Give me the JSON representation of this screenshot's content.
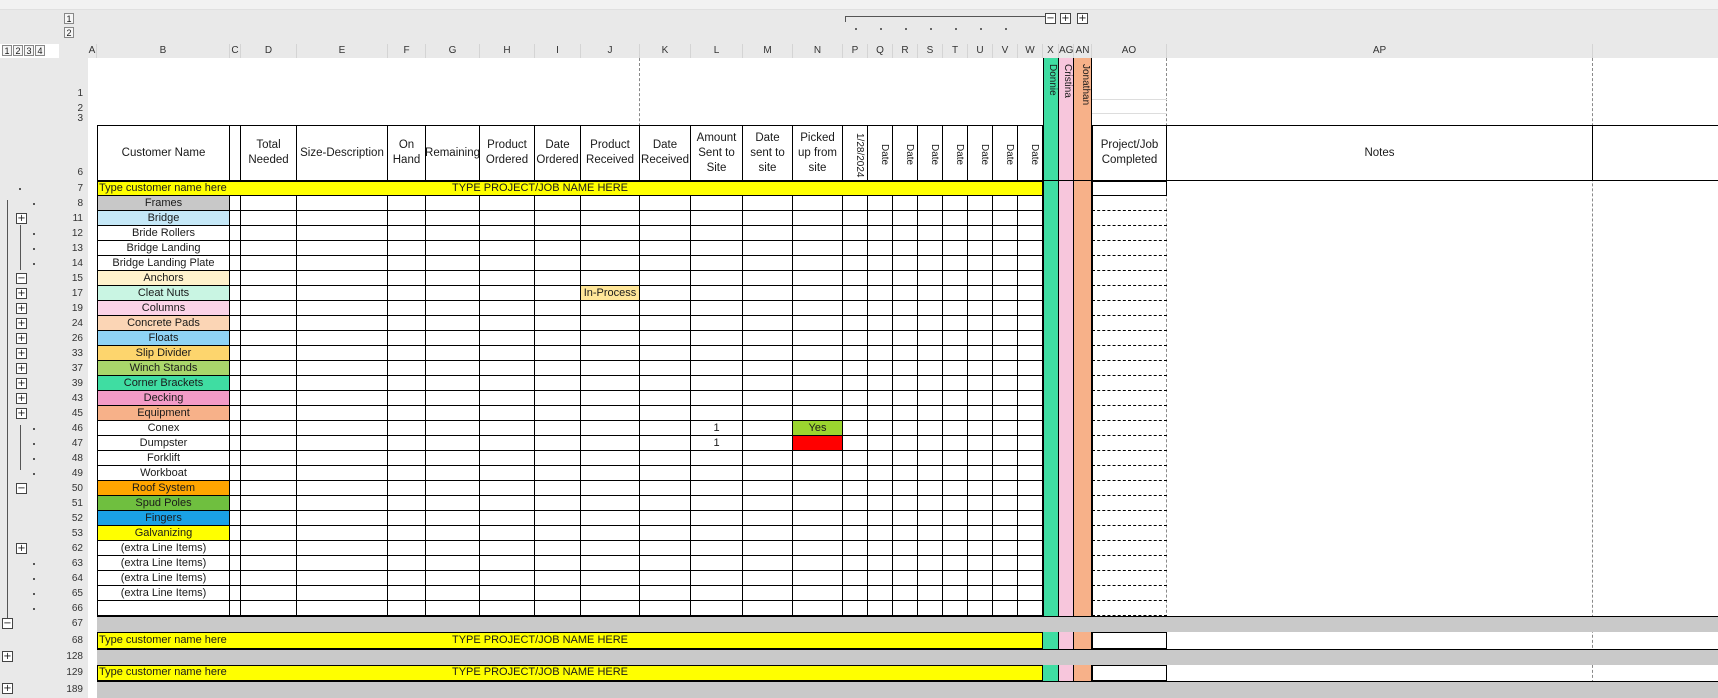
{
  "outline": {
    "row_levels": [
      "1",
      "2",
      "3",
      "4"
    ],
    "col_levels": [
      "1",
      "2"
    ]
  },
  "columns": [
    {
      "letter": "A"
    },
    {
      "letter": "B"
    },
    {
      "letter": "C"
    },
    {
      "letter": "D"
    },
    {
      "letter": "E"
    },
    {
      "letter": "F"
    },
    {
      "letter": "G"
    },
    {
      "letter": "H"
    },
    {
      "letter": "I"
    },
    {
      "letter": "J"
    },
    {
      "letter": "K"
    },
    {
      "letter": "L"
    },
    {
      "letter": "M"
    },
    {
      "letter": "N"
    },
    {
      "letter": "P"
    },
    {
      "letter": "Q"
    },
    {
      "letter": "R"
    },
    {
      "letter": "S"
    },
    {
      "letter": "T"
    },
    {
      "letter": "U"
    },
    {
      "letter": "V"
    },
    {
      "letter": "W"
    },
    {
      "letter": "X"
    },
    {
      "letter": "AG"
    },
    {
      "letter": "AN"
    },
    {
      "letter": "AO"
    },
    {
      "letter": "AP"
    }
  ],
  "headers": {
    "B": "Customer Name",
    "D": "Total Needed",
    "E": "Size-Description",
    "F": "On Hand",
    "G": "Remaining",
    "H": "Product Ordered",
    "I": "Date Ordered",
    "J": "Product Received",
    "K": "Date Received",
    "L": "Amount Sent to Site",
    "M": "Date sent to site",
    "N": "Picked up from site",
    "P": "1/28/2024",
    "Q": "Date",
    "R": "Date",
    "S": "Date",
    "T": "Date",
    "U": "Date",
    "V": "Date",
    "W": "Date",
    "AO": "Project/Job Completed",
    "AP": "Notes"
  },
  "people": {
    "X": {
      "name": "Donnie",
      "color": "#3fdda2"
    },
    "AG": {
      "name": "Cristina",
      "color": "#f7c6dc"
    },
    "AN": {
      "name": "Jonathan",
      "color": "#f7b189"
    }
  },
  "row_numbers": [
    "1",
    "2",
    "3",
    "6",
    "7",
    "8",
    "11",
    "12",
    "13",
    "14",
    "15",
    "17",
    "19",
    "24",
    "26",
    "33",
    "37",
    "39",
    "43",
    "45",
    "46",
    "47",
    "48",
    "49",
    "50",
    "51",
    "52",
    "53",
    "62",
    "63",
    "64",
    "65",
    "66",
    "67",
    "68",
    "128",
    "129",
    "189"
  ],
  "job_banner": {
    "customer_placeholder": "Type customer name here",
    "project_placeholder": "TYPE PROJECT/JOB NAME HERE",
    "color": "#ffff00"
  },
  "rows": [
    {
      "label": "Frames",
      "color": "#c8c8c8"
    },
    {
      "label": "Bridge",
      "color": "#c5e8f7"
    },
    {
      "label": "Bride Rollers",
      "color": ""
    },
    {
      "label": "Bridge Landing",
      "color": ""
    },
    {
      "label": "Bridge Landing Plate",
      "color": ""
    },
    {
      "label": "Anchors",
      "color": "#fff2cc"
    },
    {
      "label": "Cleat Nuts",
      "color": "#c9f5e3"
    },
    {
      "label": "Columns",
      "color": "#fbd3e7"
    },
    {
      "label": "Concrete Pads",
      "color": "#fbd5b5"
    },
    {
      "label": "Floats",
      "color": "#8fd3f5"
    },
    {
      "label": "Slip Divider",
      "color": "#fdd56d"
    },
    {
      "label": "Winch Stands",
      "color": "#a9d66b"
    },
    {
      "label": "Corner Brackets",
      "color": "#3fdda2"
    },
    {
      "label": "Decking",
      "color": "#f39bc7"
    },
    {
      "label": "Equipment",
      "color": "#f7b189"
    },
    {
      "label": "Conex",
      "color": ""
    },
    {
      "label": "Dumpster",
      "color": ""
    },
    {
      "label": "Forklift",
      "color": ""
    },
    {
      "label": "Workboat",
      "color": ""
    },
    {
      "label": "Roof System",
      "color": "#ffa500"
    },
    {
      "label": "Spud Poles",
      "color": "#6fbf3f"
    },
    {
      "label": "Fingers",
      "color": "#1aa1e6"
    },
    {
      "label": "Galvanizing",
      "color": "#ffff00"
    },
    {
      "label": "(extra Line Items)",
      "color": ""
    },
    {
      "label": "(extra Line Items)",
      "color": ""
    },
    {
      "label": "(extra Line Items)",
      "color": ""
    },
    {
      "label": "(extra Line Items)",
      "color": ""
    }
  ],
  "cell_values": {
    "cleat_nuts_status": "In-Process",
    "conex_amount": "1",
    "dumpster_amount": "1",
    "conex_picked_up": "Yes",
    "conex_picked_color": "#9bd62f",
    "dumpster_picked_color": "#ff0000",
    "in_process_color": "#ffe699"
  }
}
